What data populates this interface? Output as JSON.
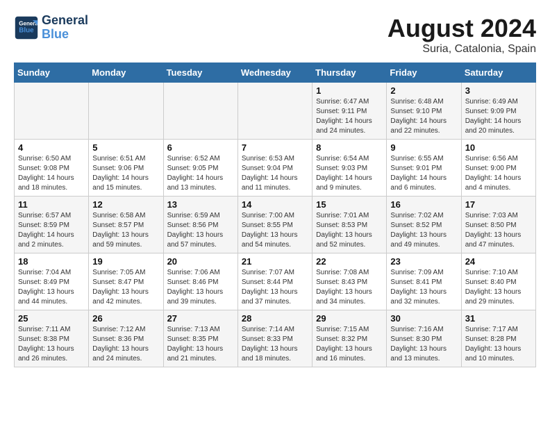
{
  "header": {
    "logo": "GeneralBlue",
    "month_year": "August 2024",
    "location": "Suria, Catalonia, Spain"
  },
  "weekdays": [
    "Sunday",
    "Monday",
    "Tuesday",
    "Wednesday",
    "Thursday",
    "Friday",
    "Saturday"
  ],
  "weeks": [
    [
      {
        "day": "",
        "info": ""
      },
      {
        "day": "",
        "info": ""
      },
      {
        "day": "",
        "info": ""
      },
      {
        "day": "",
        "info": ""
      },
      {
        "day": "1",
        "info": "Sunrise: 6:47 AM\nSunset: 9:11 PM\nDaylight: 14 hours\nand 24 minutes."
      },
      {
        "day": "2",
        "info": "Sunrise: 6:48 AM\nSunset: 9:10 PM\nDaylight: 14 hours\nand 22 minutes."
      },
      {
        "day": "3",
        "info": "Sunrise: 6:49 AM\nSunset: 9:09 PM\nDaylight: 14 hours\nand 20 minutes."
      }
    ],
    [
      {
        "day": "4",
        "info": "Sunrise: 6:50 AM\nSunset: 9:08 PM\nDaylight: 14 hours\nand 18 minutes."
      },
      {
        "day": "5",
        "info": "Sunrise: 6:51 AM\nSunset: 9:06 PM\nDaylight: 14 hours\nand 15 minutes."
      },
      {
        "day": "6",
        "info": "Sunrise: 6:52 AM\nSunset: 9:05 PM\nDaylight: 14 hours\nand 13 minutes."
      },
      {
        "day": "7",
        "info": "Sunrise: 6:53 AM\nSunset: 9:04 PM\nDaylight: 14 hours\nand 11 minutes."
      },
      {
        "day": "8",
        "info": "Sunrise: 6:54 AM\nSunset: 9:03 PM\nDaylight: 14 hours\nand 9 minutes."
      },
      {
        "day": "9",
        "info": "Sunrise: 6:55 AM\nSunset: 9:01 PM\nDaylight: 14 hours\nand 6 minutes."
      },
      {
        "day": "10",
        "info": "Sunrise: 6:56 AM\nSunset: 9:00 PM\nDaylight: 14 hours\nand 4 minutes."
      }
    ],
    [
      {
        "day": "11",
        "info": "Sunrise: 6:57 AM\nSunset: 8:59 PM\nDaylight: 14 hours\nand 2 minutes."
      },
      {
        "day": "12",
        "info": "Sunrise: 6:58 AM\nSunset: 8:57 PM\nDaylight: 13 hours\nand 59 minutes."
      },
      {
        "day": "13",
        "info": "Sunrise: 6:59 AM\nSunset: 8:56 PM\nDaylight: 13 hours\nand 57 minutes."
      },
      {
        "day": "14",
        "info": "Sunrise: 7:00 AM\nSunset: 8:55 PM\nDaylight: 13 hours\nand 54 minutes."
      },
      {
        "day": "15",
        "info": "Sunrise: 7:01 AM\nSunset: 8:53 PM\nDaylight: 13 hours\nand 52 minutes."
      },
      {
        "day": "16",
        "info": "Sunrise: 7:02 AM\nSunset: 8:52 PM\nDaylight: 13 hours\nand 49 minutes."
      },
      {
        "day": "17",
        "info": "Sunrise: 7:03 AM\nSunset: 8:50 PM\nDaylight: 13 hours\nand 47 minutes."
      }
    ],
    [
      {
        "day": "18",
        "info": "Sunrise: 7:04 AM\nSunset: 8:49 PM\nDaylight: 13 hours\nand 44 minutes."
      },
      {
        "day": "19",
        "info": "Sunrise: 7:05 AM\nSunset: 8:47 PM\nDaylight: 13 hours\nand 42 minutes."
      },
      {
        "day": "20",
        "info": "Sunrise: 7:06 AM\nSunset: 8:46 PM\nDaylight: 13 hours\nand 39 minutes."
      },
      {
        "day": "21",
        "info": "Sunrise: 7:07 AM\nSunset: 8:44 PM\nDaylight: 13 hours\nand 37 minutes."
      },
      {
        "day": "22",
        "info": "Sunrise: 7:08 AM\nSunset: 8:43 PM\nDaylight: 13 hours\nand 34 minutes."
      },
      {
        "day": "23",
        "info": "Sunrise: 7:09 AM\nSunset: 8:41 PM\nDaylight: 13 hours\nand 32 minutes."
      },
      {
        "day": "24",
        "info": "Sunrise: 7:10 AM\nSunset: 8:40 PM\nDaylight: 13 hours\nand 29 minutes."
      }
    ],
    [
      {
        "day": "25",
        "info": "Sunrise: 7:11 AM\nSunset: 8:38 PM\nDaylight: 13 hours\nand 26 minutes."
      },
      {
        "day": "26",
        "info": "Sunrise: 7:12 AM\nSunset: 8:36 PM\nDaylight: 13 hours\nand 24 minutes."
      },
      {
        "day": "27",
        "info": "Sunrise: 7:13 AM\nSunset: 8:35 PM\nDaylight: 13 hours\nand 21 minutes."
      },
      {
        "day": "28",
        "info": "Sunrise: 7:14 AM\nSunset: 8:33 PM\nDaylight: 13 hours\nand 18 minutes."
      },
      {
        "day": "29",
        "info": "Sunrise: 7:15 AM\nSunset: 8:32 PM\nDaylight: 13 hours\nand 16 minutes."
      },
      {
        "day": "30",
        "info": "Sunrise: 7:16 AM\nSunset: 8:30 PM\nDaylight: 13 hours\nand 13 minutes."
      },
      {
        "day": "31",
        "info": "Sunrise: 7:17 AM\nSunset: 8:28 PM\nDaylight: 13 hours\nand 10 minutes."
      }
    ]
  ]
}
